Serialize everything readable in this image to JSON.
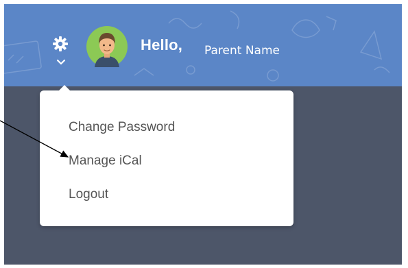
{
  "header": {
    "greeting": "Hello,",
    "user_name": "Parent Name",
    "settings_icon": "gear-icon",
    "dropdown_icon": "chevron-down-icon",
    "avatar_icon": "user-avatar"
  },
  "menu": {
    "items": [
      {
        "label": "Change Password"
      },
      {
        "label": "Manage iCal"
      },
      {
        "label": "Logout"
      }
    ]
  },
  "colors": {
    "header": "#5b86c7",
    "page_background": "#4d5669",
    "menu_background": "#ffffff",
    "menu_text": "#555555",
    "header_text": "#ffffff"
  }
}
